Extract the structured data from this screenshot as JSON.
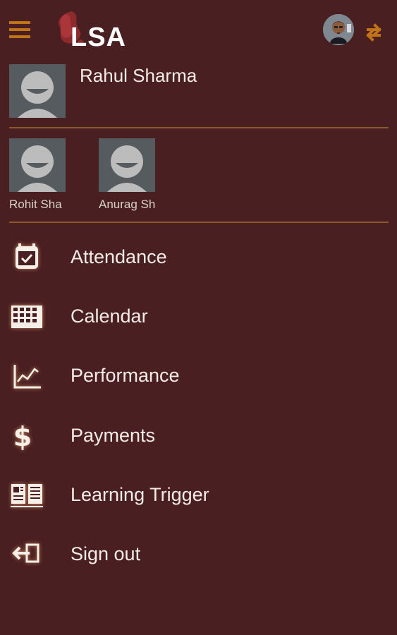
{
  "app": {
    "logo_text": "LSA",
    "accent_color": "#c07318",
    "background_color": "#4a1f21"
  },
  "header": {
    "menu_icon": "hamburger-icon",
    "avatar_icon": "user-photo",
    "switch_icon": "swap-arrows-icon"
  },
  "profile": {
    "name": "Rahul Sharma",
    "avatar_icon": "default-user-avatar"
  },
  "children": [
    {
      "name": "Rohit Sha",
      "avatar_icon": "default-user-avatar"
    },
    {
      "name": "Anurag Sh",
      "avatar_icon": "default-user-avatar"
    }
  ],
  "menu": [
    {
      "label": "Attendance",
      "icon": "calendar-check-icon"
    },
    {
      "label": "Calendar",
      "icon": "calendar-grid-icon"
    },
    {
      "label": "Performance",
      "icon": "line-chart-icon"
    },
    {
      "label": "Payments",
      "icon": "dollar-icon"
    },
    {
      "label": "Learning Trigger",
      "icon": "book-icon"
    },
    {
      "label": "Sign out",
      "icon": "sign-out-icon"
    }
  ]
}
